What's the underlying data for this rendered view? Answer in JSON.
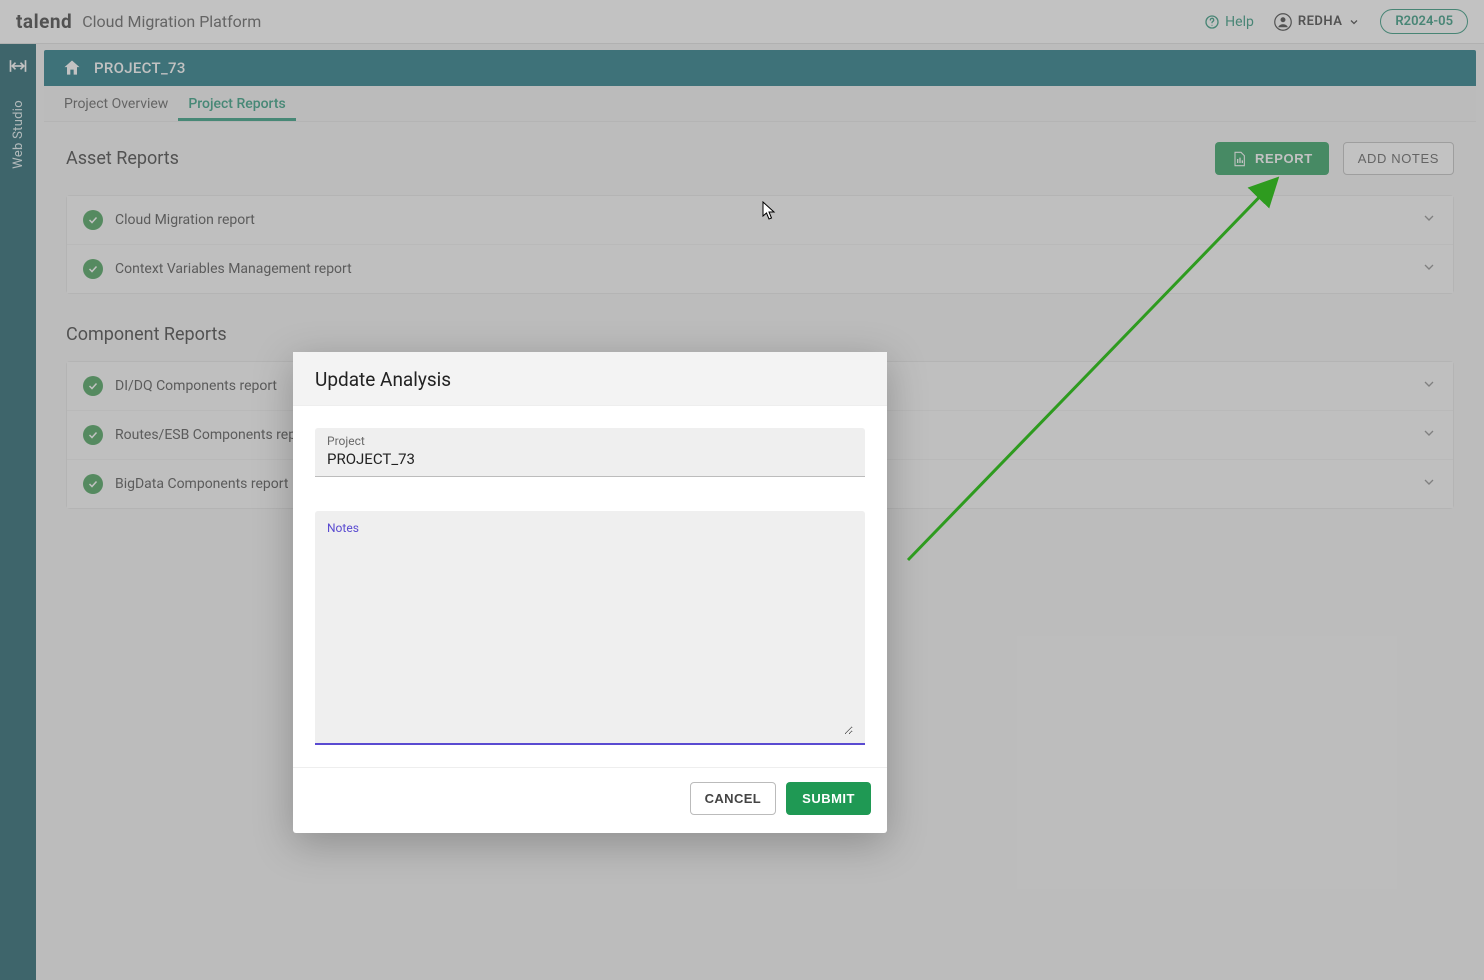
{
  "topbar": {
    "brand": "talend",
    "subtitle": "Cloud Migration Platform",
    "help": "Help",
    "user": "REDHA",
    "version": "R2024-05"
  },
  "sidebar": {
    "label": "Web Studio"
  },
  "project": {
    "name": "PROJECT_73"
  },
  "tabs": [
    {
      "label": "Project Overview",
      "active": false
    },
    {
      "label": "Project Reports",
      "active": true
    }
  ],
  "sections": {
    "asset_title": "Asset Reports",
    "component_title": "Component Reports",
    "report_button": "REPORT",
    "addnotes_button": "ADD NOTES"
  },
  "asset_reports": [
    {
      "label": "Cloud Migration report"
    },
    {
      "label": "Context Variables Management report"
    }
  ],
  "component_reports": [
    {
      "label": "DI/DQ Components report"
    },
    {
      "label": "Routes/ESB Components report"
    },
    {
      "label": "BigData Components report"
    }
  ],
  "modal": {
    "title": "Update Analysis",
    "project_label": "Project",
    "project_value": "PROJECT_73",
    "notes_label": "Notes",
    "notes_value": "",
    "cancel": "CANCEL",
    "submit": "SUBMIT"
  }
}
